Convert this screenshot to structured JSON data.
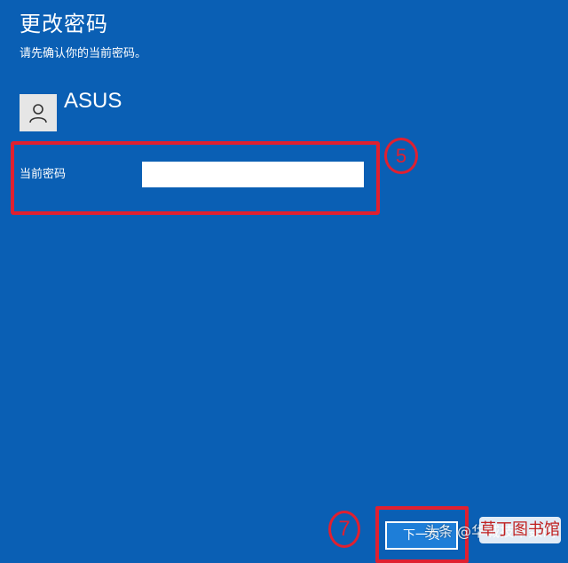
{
  "dialog": {
    "title": "更改密码",
    "subtitle": "请先确认你的当前密码。"
  },
  "account": {
    "name": "ASUS",
    "avatar_icon": "user-icon"
  },
  "password_field": {
    "label": "当前密码",
    "value": "",
    "placeholder": ""
  },
  "buttons": {
    "next_label": "下一页"
  },
  "annotations": {
    "step_5": "5",
    "step_7": "7",
    "color": "#e02030"
  },
  "watermark": {
    "text": "头条 @华城技术数码",
    "badge": "草丁图书馆"
  },
  "colors": {
    "background": "#0a5fb4",
    "button": "#1e7ed8",
    "text": "#ffffff"
  }
}
